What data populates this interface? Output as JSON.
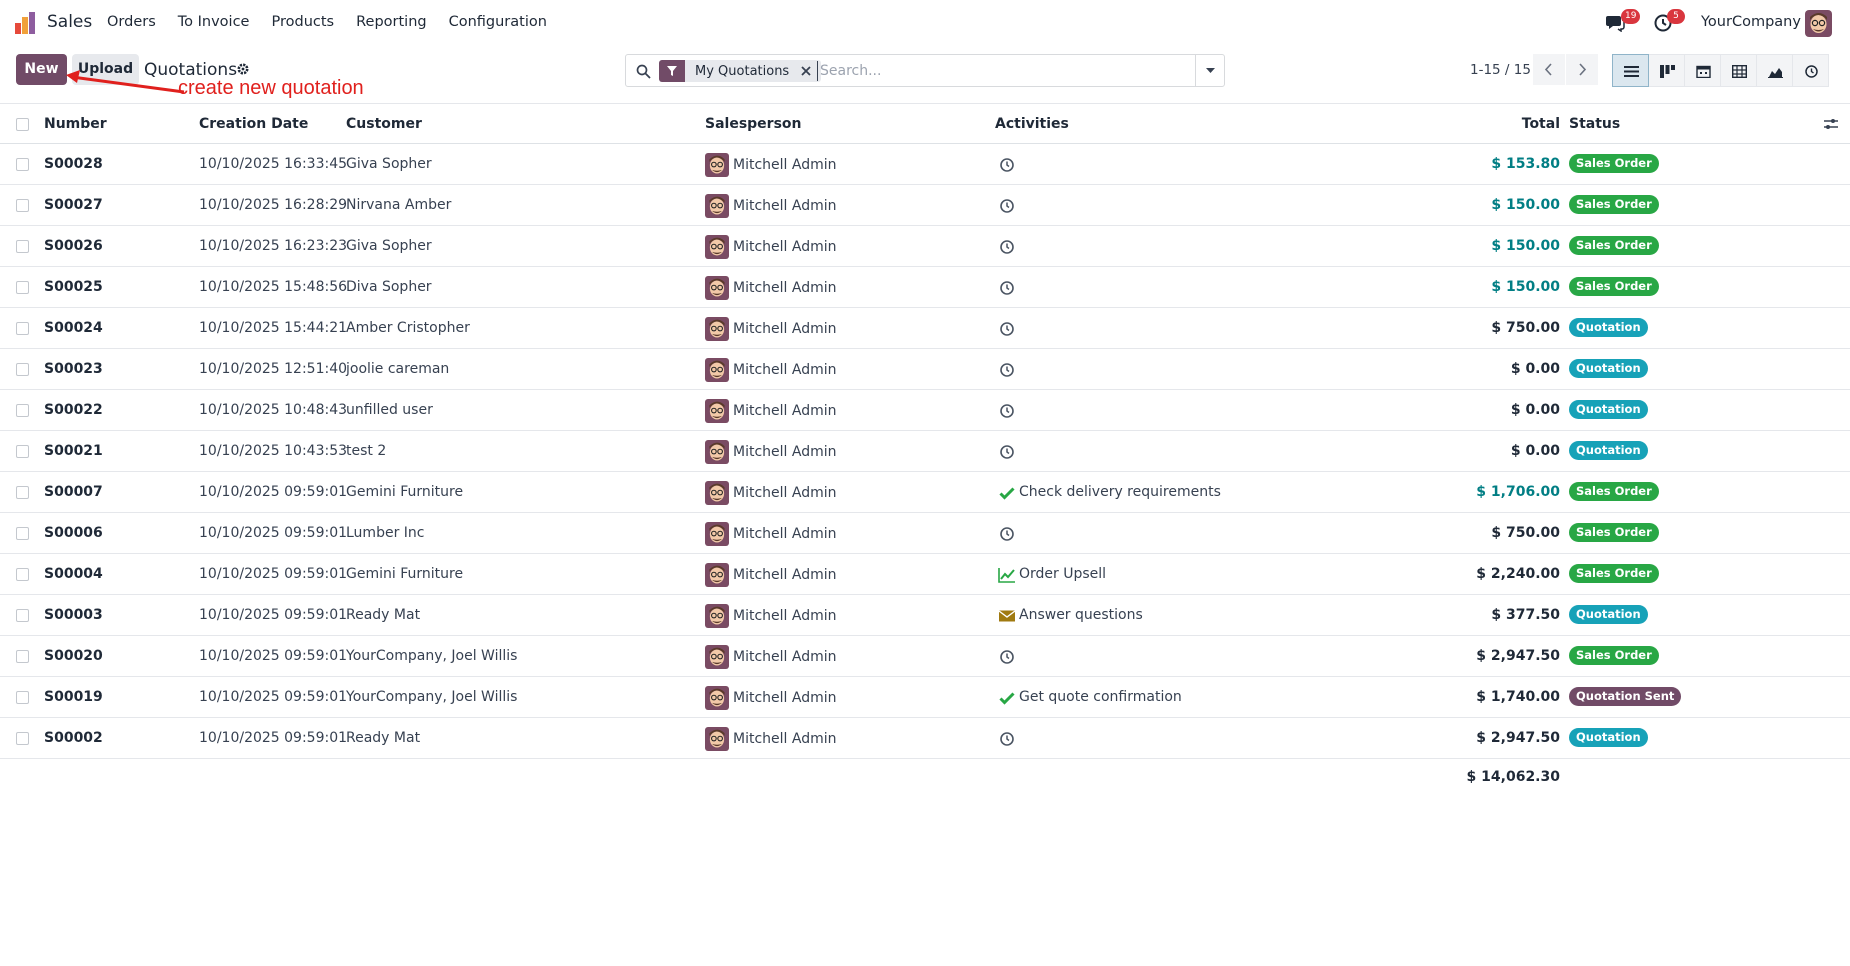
{
  "navbar": {
    "app_name": "Sales",
    "menu": [
      "Orders",
      "To Invoice",
      "Products",
      "Reporting",
      "Configuration"
    ],
    "messages_count": "19",
    "activities_count": "5",
    "company": "YourCompany"
  },
  "control_panel": {
    "new_label": "New",
    "upload_label": "Upload",
    "title": "Quotations",
    "annotation": "create new quotation",
    "facet_label": "My Quotations",
    "search_placeholder": "Search...",
    "pager": "1-15 / 15"
  },
  "columns": {
    "number": "Number",
    "creation_date": "Creation Date",
    "customer": "Customer",
    "salesperson": "Salesperson",
    "activities": "Activities",
    "total": "Total",
    "status": "Status"
  },
  "rows": [
    {
      "number": "S00028",
      "date": "10/10/2025 16:33:45",
      "customer": "Giva Sopher",
      "salesperson": "Mitchell Admin",
      "activity_icon": "clock-icon",
      "activity": "",
      "total": "$ 153.80",
      "total_highlight": true,
      "status": "Sales Order",
      "status_kind": "so"
    },
    {
      "number": "S00027",
      "date": "10/10/2025 16:28:29",
      "customer": "Nirvana Amber",
      "salesperson": "Mitchell Admin",
      "activity_icon": "clock-icon",
      "activity": "",
      "total": "$ 150.00",
      "total_highlight": true,
      "status": "Sales Order",
      "status_kind": "so"
    },
    {
      "number": "S00026",
      "date": "10/10/2025 16:23:23",
      "customer": "Giva Sopher",
      "salesperson": "Mitchell Admin",
      "activity_icon": "clock-icon",
      "activity": "",
      "total": "$ 150.00",
      "total_highlight": true,
      "status": "Sales Order",
      "status_kind": "so"
    },
    {
      "number": "S00025",
      "date": "10/10/2025 15:48:56",
      "customer": "Diva Sopher",
      "salesperson": "Mitchell Admin",
      "activity_icon": "clock-icon",
      "activity": "",
      "total": "$ 150.00",
      "total_highlight": true,
      "status": "Sales Order",
      "status_kind": "so"
    },
    {
      "number": "S00024",
      "date": "10/10/2025 15:44:21",
      "customer": "Amber Cristopher",
      "salesperson": "Mitchell Admin",
      "activity_icon": "clock-icon",
      "activity": "",
      "total": "$ 750.00",
      "total_highlight": false,
      "status": "Quotation",
      "status_kind": "q"
    },
    {
      "number": "S00023",
      "date": "10/10/2025 12:51:40",
      "customer": "joolie careman",
      "salesperson": "Mitchell Admin",
      "activity_icon": "clock-icon",
      "activity": "",
      "total": "$ 0.00",
      "total_highlight": false,
      "status": "Quotation",
      "status_kind": "q"
    },
    {
      "number": "S00022",
      "date": "10/10/2025 10:48:43",
      "customer": "unfilled user",
      "salesperson": "Mitchell Admin",
      "activity_icon": "clock-icon",
      "activity": "",
      "total": "$ 0.00",
      "total_highlight": false,
      "status": "Quotation",
      "status_kind": "q"
    },
    {
      "number": "S00021",
      "date": "10/10/2025 10:43:53",
      "customer": "test 2",
      "salesperson": "Mitchell Admin",
      "activity_icon": "clock-icon",
      "activity": "",
      "total": "$ 0.00",
      "total_highlight": false,
      "status": "Quotation",
      "status_kind": "q"
    },
    {
      "number": "S00007",
      "date": "10/10/2025 09:59:01",
      "customer": "Gemini Furniture",
      "salesperson": "Mitchell Admin",
      "activity_icon": "check-icon",
      "activity": "Check delivery requirements",
      "total": "$ 1,706.00",
      "total_highlight": true,
      "status": "Sales Order",
      "status_kind": "so"
    },
    {
      "number": "S00006",
      "date": "10/10/2025 09:59:01",
      "customer": "Lumber Inc",
      "salesperson": "Mitchell Admin",
      "activity_icon": "clock-icon",
      "activity": "",
      "total": "$ 750.00",
      "total_highlight": false,
      "status": "Sales Order",
      "status_kind": "so"
    },
    {
      "number": "S00004",
      "date": "10/10/2025 09:59:01",
      "customer": "Gemini Furniture",
      "salesperson": "Mitchell Admin",
      "activity_icon": "chart-line-icon",
      "activity": "Order Upsell",
      "total": "$ 2,240.00",
      "total_highlight": false,
      "status": "Sales Order",
      "status_kind": "so"
    },
    {
      "number": "S00003",
      "date": "10/10/2025 09:59:01",
      "customer": "Ready Mat",
      "salesperson": "Mitchell Admin",
      "activity_icon": "envelope-icon",
      "activity": "Answer questions",
      "total": "$ 377.50",
      "total_highlight": false,
      "status": "Quotation",
      "status_kind": "q"
    },
    {
      "number": "S00020",
      "date": "10/10/2025 09:59:01",
      "customer": "YourCompany, Joel Willis",
      "salesperson": "Mitchell Admin",
      "activity_icon": "clock-icon",
      "activity": "",
      "total": "$ 2,947.50",
      "total_highlight": false,
      "status": "Sales Order",
      "status_kind": "so"
    },
    {
      "number": "S00019",
      "date": "10/10/2025 09:59:01",
      "customer": "YourCompany, Joel Willis",
      "salesperson": "Mitchell Admin",
      "activity_icon": "check-icon",
      "activity": "Get quote confirmation",
      "total": "$ 1,740.00",
      "total_highlight": false,
      "status": "Quotation Sent",
      "status_kind": "qs"
    },
    {
      "number": "S00002",
      "date": "10/10/2025 09:59:01",
      "customer": "Ready Mat",
      "salesperson": "Mitchell Admin",
      "activity_icon": "clock-icon",
      "activity": "",
      "total": "$ 2,947.50",
      "total_highlight": false,
      "status": "Quotation",
      "status_kind": "q"
    }
  ],
  "grand_total": "$ 14,062.30",
  "colors": {
    "brand": "#714b67",
    "sales_order": "#28a745",
    "quotation": "#17a2b8",
    "highlight_total": "#017e84"
  }
}
